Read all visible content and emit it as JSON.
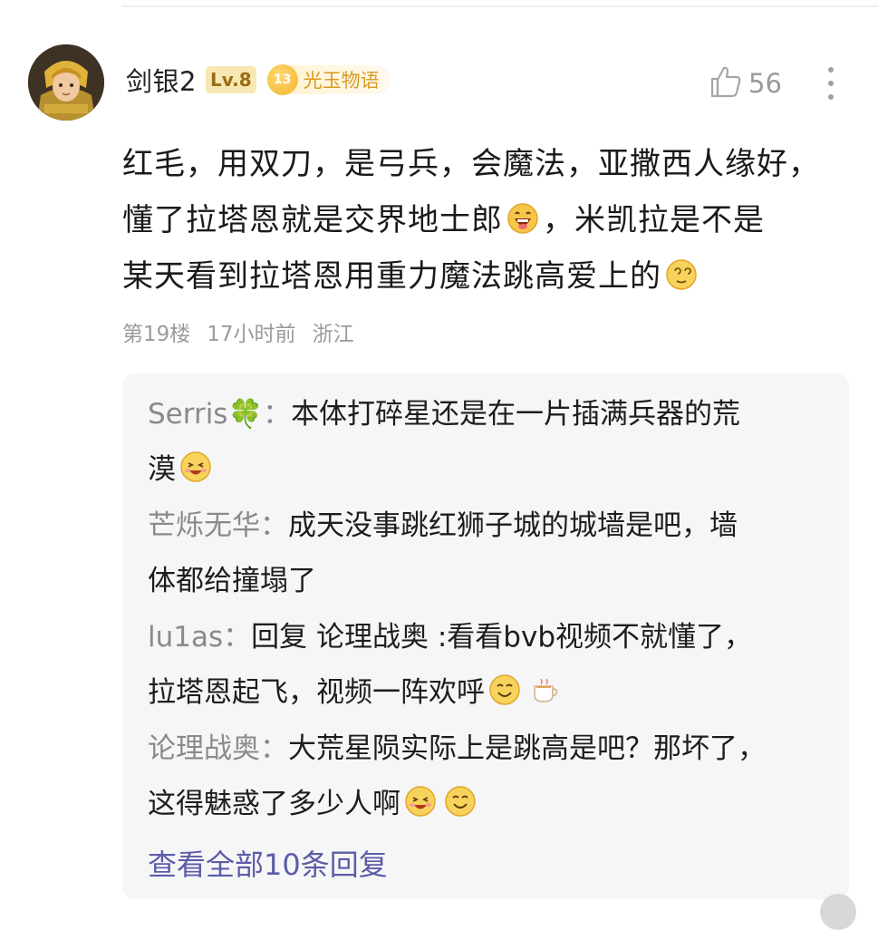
{
  "comment": {
    "username": "剑银2",
    "level": "Lv.8",
    "fan_badge": {
      "medal_level": "13",
      "name": "光玉物语"
    },
    "like_count": "56",
    "body_lines": [
      "红毛，用双刀，是弓兵，会魔法，亚撒西人缘好，",
      "懂了拉塔恩就是交界地士郎",
      "，米凯拉是不是",
      "某天看到拉塔恩用重力魔法跳高爱上的"
    ],
    "meta": {
      "floor": "第19楼",
      "time": "17小时前",
      "location": "浙江"
    }
  },
  "replies": [
    {
      "name": "Serris🍀",
      "colon": "：",
      "lines": [
        "本体打碎星还是在一片插满兵器的荒",
        "漠"
      ]
    },
    {
      "name": "芒烁无华",
      "colon": "：",
      "lines": [
        "成天没事跳红狮子城的城墙是吧，墙",
        "体都给撞塌了"
      ]
    },
    {
      "name": "lu1as",
      "colon": "：",
      "lines": [
        "回复 论理战奥 :看看bvb视频不就懂了，",
        "拉塔恩起飞，视频一阵欢呼"
      ]
    },
    {
      "name": "论理战奥",
      "colon": "：",
      "lines": [
        "大荒星陨实际上是跳高是吧？那坏了，",
        "这得魅惑了多少人啊"
      ]
    }
  ],
  "view_all": "查看全部10条回复",
  "icons": {
    "like": "thumbs-up-icon",
    "more": "more-vertical-icon",
    "emoji_laugh": "grin-emoji",
    "emoji_dizzy": "dizzy-emoji",
    "emoji_giggle": "giggle-emoji",
    "emoji_smile": "smile-emoji",
    "emoji_tea": "tea-cup-emoji"
  },
  "colors": {
    "reply_background": "#f6f6f7",
    "link": "#5b5ca8",
    "level_badge_bg": "#f7e7b4",
    "level_badge_text": "#9a6d11",
    "fan_badge_text": "#d99a1e"
  }
}
